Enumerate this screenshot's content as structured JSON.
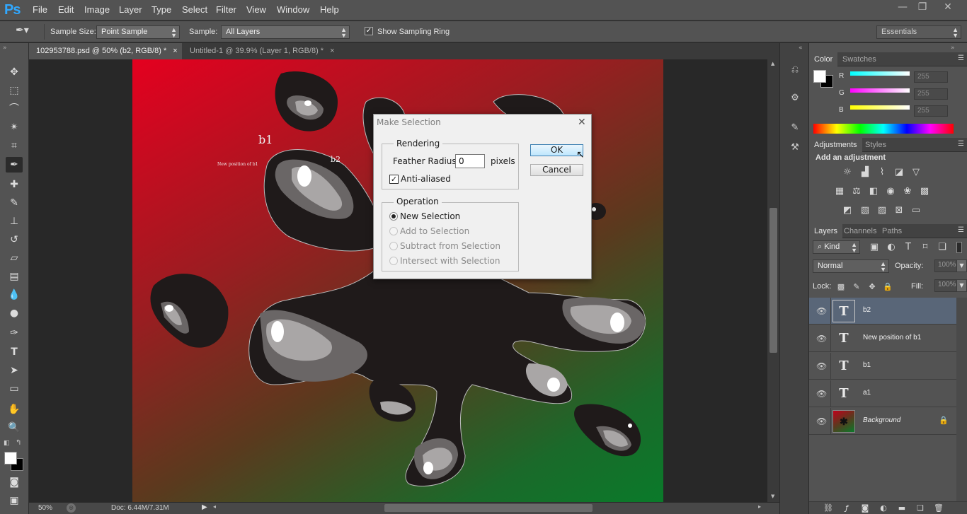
{
  "app": {
    "logo": "Ps"
  },
  "menus": [
    "File",
    "Edit",
    "Image",
    "Layer",
    "Type",
    "Select",
    "Filter",
    "View",
    "Window",
    "Help"
  ],
  "window_controls": {
    "minimize": "—",
    "restore": "❐",
    "close": "✕"
  },
  "options": {
    "sample_size_label": "Sample Size:",
    "sample_size_value": "Point Sample",
    "sample_label": "Sample:",
    "sample_value": "All Layers",
    "show_ring_label": "Show Sampling Ring",
    "workspace": "Essentials"
  },
  "tabs": [
    {
      "label": "102953788.psd @ 50% (b2, RGB/8) *",
      "close": "×"
    },
    {
      "label": "Untitled-1 @ 39.9% (Layer 1, RGB/8) *",
      "close": "×"
    }
  ],
  "canvas_text": {
    "b1": "b1",
    "b2": "b2",
    "new_position": "New position of b1"
  },
  "status": {
    "zoom": "50%",
    "doc": "Doc: 6.44M/7.31M"
  },
  "color_panel": {
    "tabs": [
      "Color",
      "Swatches"
    ],
    "r_label": "R",
    "g_label": "G",
    "b_label": "B",
    "r_value": "255",
    "g_value": "255",
    "b_value": "255"
  },
  "adjustments_panel": {
    "tabs": [
      "Adjustments",
      "Styles"
    ],
    "heading": "Add an adjustment"
  },
  "layers_panel": {
    "tabs": [
      "Layers",
      "Channels",
      "Paths"
    ],
    "filter": "Kind",
    "blend_mode": "Normal",
    "opacity_label": "Opacity:",
    "opacity_value": "100%",
    "lock_label": "Lock:",
    "fill_label": "Fill:",
    "fill_value": "100%",
    "layers": [
      {
        "name": "b2"
      },
      {
        "name": "New position of b1"
      },
      {
        "name": "b1"
      },
      {
        "name": "a1"
      },
      {
        "name": "Background"
      }
    ]
  },
  "dialog": {
    "title": "Make Selection",
    "rendering_label": "Rendering",
    "feather_label": "Feather Radius:",
    "feather_value": "0",
    "feather_unit": "pixels",
    "antialias_label": "Anti-aliased",
    "operation_label": "Operation",
    "ok": "OK",
    "cancel": "Cancel",
    "operations": [
      "New Selection",
      "Add to Selection",
      "Subtract from Selection",
      "Intersect with Selection"
    ]
  }
}
